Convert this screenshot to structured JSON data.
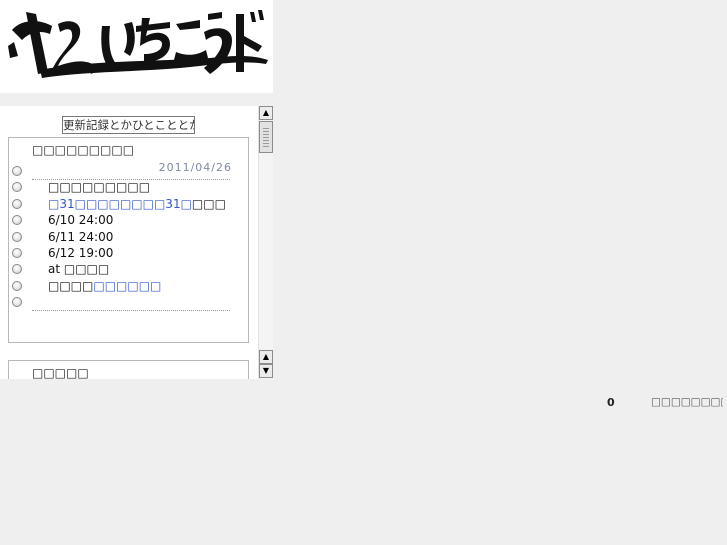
{
  "header": {
    "logo_alt": "やみいちこうどう"
  },
  "panel": {
    "title_button": "更新記録とかひとこととか",
    "box1": {
      "heading": "□□□□□□□□□",
      "date": "2011/04/26",
      "rows": [
        {
          "parts": []
        },
        {
          "parts": [
            {
              "t": "□□□□□□□□□",
              "c": "lbl"
            }
          ]
        },
        {
          "parts": [
            {
              "t": "□31□□□□□□□□31□",
              "c": "lnk"
            },
            {
              "t": "□□□",
              "c": "lbl"
            }
          ]
        },
        {
          "parts": [
            {
              "t": "6/10 24:00",
              "c": "gray"
            }
          ]
        },
        {
          "parts": [
            {
              "t": "6/11 24:00",
              "c": "gray"
            }
          ]
        },
        {
          "parts": [
            {
              "t": "6/12 19:00",
              "c": "gray"
            }
          ]
        },
        {
          "parts": [
            {
              "t": "at ",
              "c": "gray"
            },
            {
              "t": "□□□□",
              "c": "lbl"
            }
          ]
        },
        {
          "parts": [
            {
              "t": "□□□□",
              "c": "lbl"
            },
            {
              "t": "□□□□□□",
              "c": "lnk"
            }
          ]
        },
        {
          "parts": []
        }
      ]
    },
    "box2": {
      "heading": "□□□□□"
    }
  },
  "scrollbar": {
    "up_arrow_icon": "triangle-up",
    "down_arrow_icon": "triangle-down"
  },
  "footer": {
    "count": "0",
    "text": "□□□□□□□□□□□□□"
  }
}
